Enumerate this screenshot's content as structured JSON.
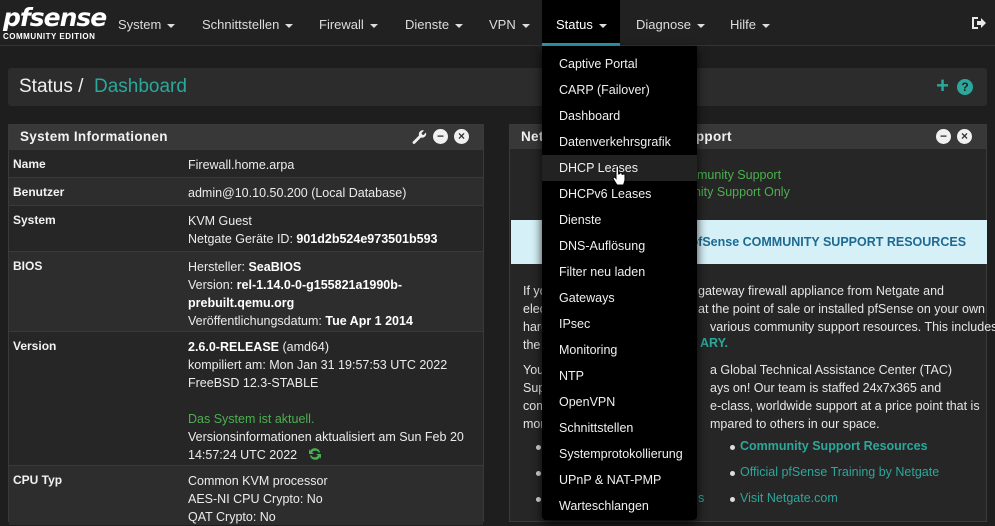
{
  "brand": {
    "name": "pfsense",
    "edition": "COMMUNITY EDITION"
  },
  "nav": {
    "items": [
      {
        "label": "System"
      },
      {
        "label": "Schnittstellen"
      },
      {
        "label": "Firewall"
      },
      {
        "label": "Dienste"
      },
      {
        "label": "VPN"
      },
      {
        "label": "Status"
      },
      {
        "label": "Diagnose"
      },
      {
        "label": "Hilfe"
      }
    ],
    "active": "Status"
  },
  "breadcrumb": {
    "section": "Status",
    "sep": "/",
    "page": "Dashboard"
  },
  "sysinfo": {
    "title": "System Informationen",
    "rows": {
      "name": {
        "label": "Name",
        "value": "Firewall.home.arpa"
      },
      "user": {
        "label": "Benutzer",
        "value": "admin@10.10.50.200 (Local Database)"
      },
      "system": {
        "label": "System",
        "line1": "KVM Guest",
        "line2_prefix": "Netgate Geräte ID:",
        "line2_value": "901d2b524e973501b593"
      },
      "bios": {
        "label": "BIOS",
        "vendor_prefix": "Hersteller:",
        "vendor": "SeaBIOS",
        "version_prefix": "Version:",
        "version_a": "rel-1.14.0-0-g155821a1990b-",
        "version_b": "prebuilt.qemu.org",
        "date_prefix": "Veröffentlichungsdatum:",
        "date": "Tue Apr 1 2014"
      },
      "version": {
        "label": "Version",
        "release": "2.6.0-RELEASE",
        "arch": "(amd64)",
        "compiled": "kompiliert am: Mon Jan 31 19:57:53 UTC 2022",
        "freebsd": "FreeBSD 12.3-STABLE",
        "uptodate": "Das System ist aktuell.",
        "updated_a": "Versionsinformationen aktualisiert am Sun Feb 20",
        "updated_b": "14:57:24 UTC 2022"
      },
      "cpu": {
        "label": "CPU Typ",
        "line1": "Common KVM processor",
        "line2": "AES-NI CPU Crypto: No",
        "line3": "QAT Crypto: No"
      }
    }
  },
  "support": {
    "title_a": "Netg",
    "title_b": "Support",
    "link1": "munity Support",
    "link2": "unity Support Only",
    "banner_a": "ND pfSense COMMUNITY SUPPORT RESOURCES",
    "p1_l1a": "If yo",
    "p1_l1b": "gateway firewall appliance from Netgate and",
    "p1_l2a": "elec",
    "p1_l2b": "at the point of sale or installed pfSense on your own",
    "p1_l3a": "harc",
    "p1_l3b": "various community support resources. This includes",
    "p1_l4a": "the",
    "p1_l4b": "ARY.",
    "p2_l1a": "You",
    "p2_l1b": "a Global Technical Assistance Center (TAC)",
    "p2_l2a": "Supp",
    "p2_l2b": "ays on! Our team is staffed 24x7x365 and",
    "p2_l3a": "com",
    "p2_l3b": "e-class, worldwide support at a price point that is",
    "p2_l4a": "mor",
    "p2_l4b": "mpared to others in our space.",
    "res1": "Community Support Resources",
    "res2": "Official pfSense Training by Netgate",
    "res3": "Visit Netgate.com",
    "res3_left": "s"
  },
  "status_menu": {
    "items": [
      "Captive Portal",
      "CARP (Failover)",
      "Dashboard",
      "Datenverkehrsgrafik",
      "DHCP Leases",
      "DHCPv6 Leases",
      "Dienste",
      "DNS-Auflösung",
      "Filter neu laden",
      "Gateways",
      "IPsec",
      "Monitoring",
      "NTP",
      "OpenVPN",
      "Schnittstellen",
      "Systemprotokollierung",
      "UPnP & NAT-PMP",
      "Warteschlangen"
    ],
    "hovered": "DHCP Leases"
  },
  "colors": {
    "accent": "#2ba79b",
    "ok": "#4caf50",
    "banner_bg": "#d6f0f7",
    "banner_text": "#1c6a93"
  }
}
